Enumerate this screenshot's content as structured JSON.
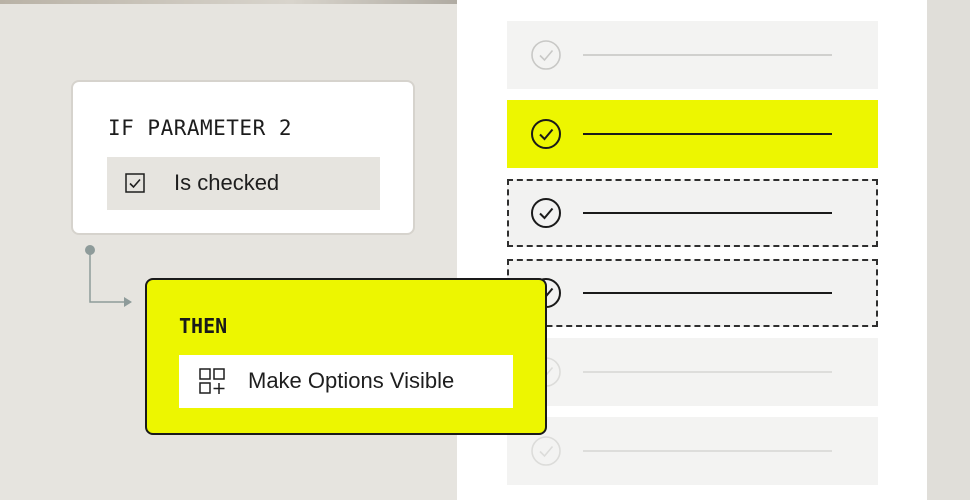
{
  "condition_card": {
    "title": "IF PARAMETER 2",
    "condition_label": "Is checked",
    "checkbox_icon": "checkbox-checked-icon"
  },
  "action_card": {
    "title": "THEN",
    "action_label": "Make Options Visible",
    "action_icon": "add-grid-icon"
  },
  "options_list": {
    "rows": [
      {
        "state": "faded",
        "icon": "check-circle-icon"
      },
      {
        "state": "highlighted",
        "icon": "check-circle-icon"
      },
      {
        "state": "dashed",
        "icon": "check-circle-icon"
      },
      {
        "state": "dashed",
        "icon": "check-circle-icon"
      },
      {
        "state": "faded",
        "icon": "check-circle-icon"
      },
      {
        "state": "faded",
        "icon": "check-circle-icon"
      }
    ]
  },
  "colors": {
    "accent_yellow": "#EDF600",
    "background": "#E6E4DF",
    "panel": "#FFFFFF",
    "ink": "#1A1A1A",
    "connector": "#8E9B9A"
  }
}
